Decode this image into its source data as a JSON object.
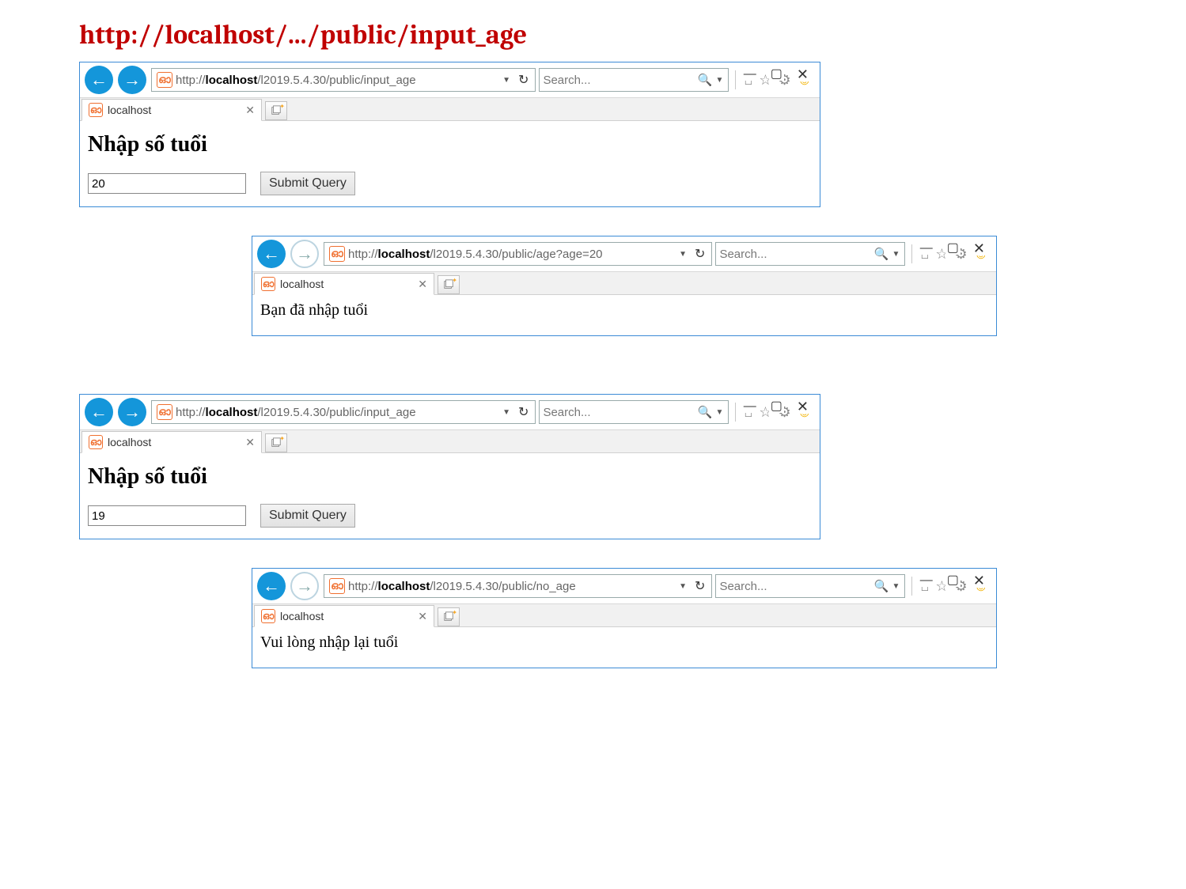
{
  "slide_title": "http://localhost/.../public/input_age",
  "search_placeholder": "Search...",
  "tab": {
    "title": "localhost"
  },
  "cluster1": {
    "input_window": {
      "url_prefix": "http://",
      "url_host": "localhost",
      "url_path": "/l2019.5.4.30/public/input_age",
      "heading": "Nhập số tuổi",
      "input_value": "20",
      "submit_label": "Submit Query"
    },
    "result_window": {
      "url_prefix": "http://",
      "url_host": "localhost",
      "url_path": "/l2019.5.4.30/public/age?age=20",
      "body_text": "Bạn đã nhập tuổi"
    }
  },
  "cluster2": {
    "input_window": {
      "url_prefix": "http://",
      "url_host": "localhost",
      "url_path": "/l2019.5.4.30/public/input_age",
      "heading": "Nhập số tuổi",
      "input_value": "19",
      "submit_label": "Submit Query"
    },
    "result_window": {
      "url_prefix": "http://",
      "url_host": "localhost",
      "url_path": "/l2019.5.4.30/public/no_age",
      "body_text": "Vui lòng nhập lại tuổi"
    }
  }
}
